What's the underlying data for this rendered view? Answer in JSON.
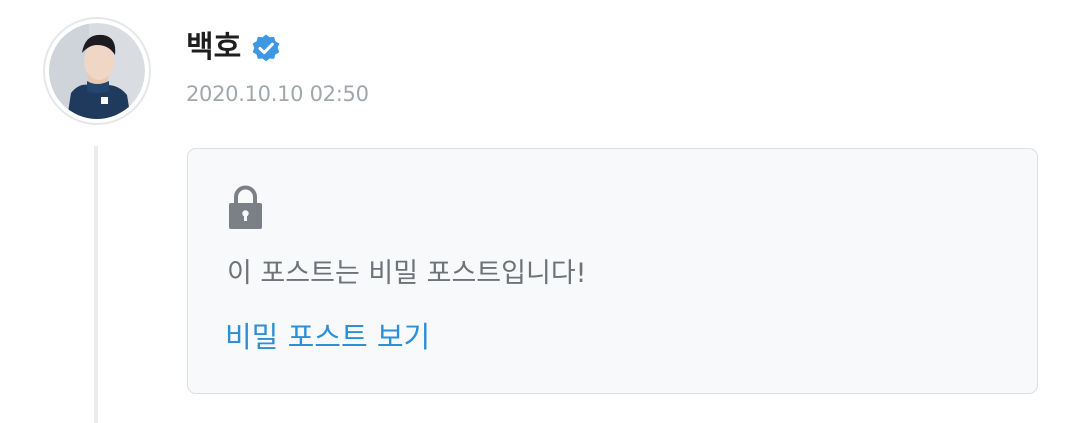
{
  "post": {
    "author": {
      "name": "백호",
      "verified": true,
      "avatar_icon": "profile-photo"
    },
    "timestamp": "2020.10.10 02:50",
    "secret_notice": {
      "icon": "lock-icon",
      "message": "이 포스트는 비밀 포스트입니다!",
      "link_label": "비밀 포스트 보기"
    }
  },
  "colors": {
    "verified_badge": "#3d97e3",
    "link": "#2d8fd5",
    "muted_text": "#a2a7ad",
    "message_text": "#6e737a",
    "card_background": "#f8f9fa",
    "card_border": "#dcdfe3",
    "thread_line": "#ececee"
  }
}
